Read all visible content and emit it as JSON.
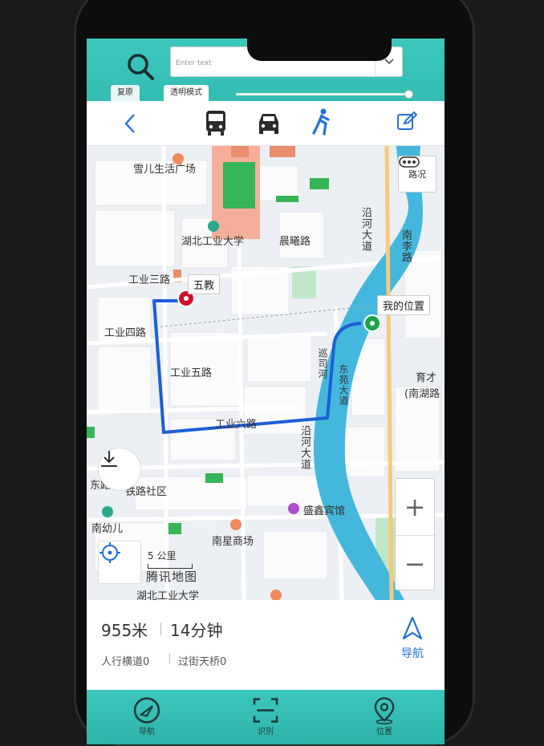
{
  "search": {
    "placeholder": "Enter text",
    "value": ""
  },
  "tabs": [
    {
      "label": "复原"
    },
    {
      "label": "透明模式"
    }
  ],
  "transparency_slider": {
    "level": 1.0
  },
  "modes": [
    {
      "name": "bus"
    },
    {
      "name": "car"
    },
    {
      "name": "walk",
      "selected": true
    }
  ],
  "map": {
    "traffic_label": "路况",
    "start_label": "五教",
    "end_label": "我的位置",
    "scale_label": "5 公里",
    "logo": "腾讯地图",
    "places": {
      "p1": "雪儿生活广场",
      "p2": "湖北工业大学",
      "p3": "晨曦路",
      "p4": "沿河大道",
      "p5": "南李路",
      "p6": "工业三路",
      "p7": "工业四路",
      "p8": "工业五路",
      "p9": "巡司河",
      "p10": "东苑大道",
      "p11": "育才",
      "p12": "(南湖路",
      "p13": "工业六路",
      "p14": "沿河大道",
      "p15": "铁路社区",
      "p16": "盛鑫宾馆",
      "p17": "南幼儿",
      "p18": "南星商场",
      "p19": "湖北工业大学",
      "p20": "东路"
    }
  },
  "route_info": {
    "distance": "955米",
    "duration": "14分钟",
    "crosswalks": "人行横道0",
    "overpasses": "过街天桥0",
    "nav_label": "导航"
  },
  "bottom_nav": [
    {
      "label": "导航"
    },
    {
      "label": "识别"
    },
    {
      "label": "位置"
    }
  ],
  "colors": {
    "teal": "#35bfb4",
    "route": "#1b5fd6",
    "river": "#44b8dc",
    "start_pin": "#d0102a",
    "end_pin": "#1aa34a"
  }
}
